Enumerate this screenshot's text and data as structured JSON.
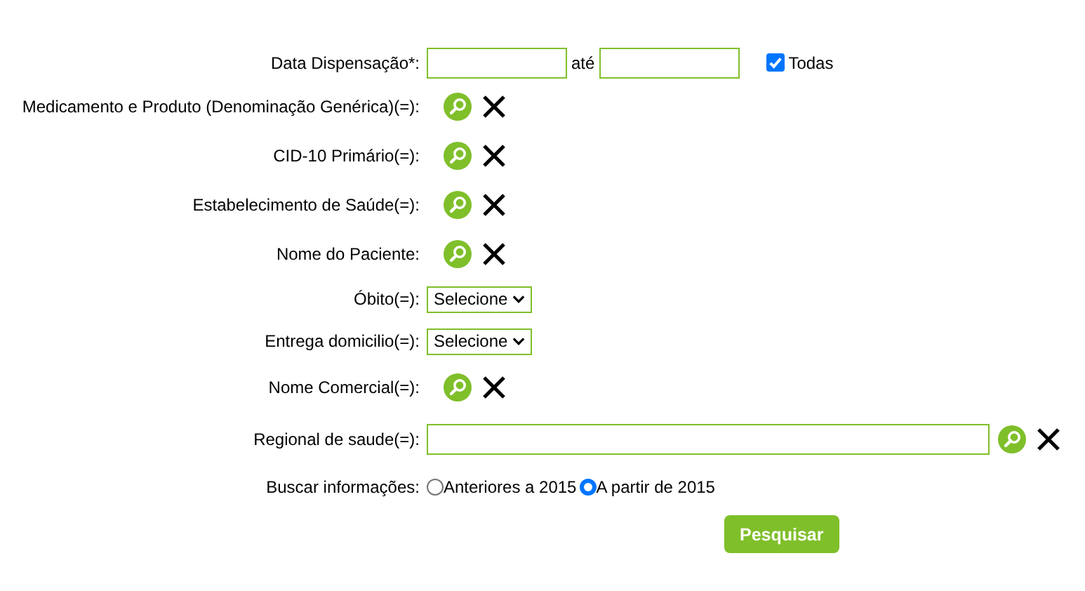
{
  "fields": [
    {
      "kind": "date_range",
      "label": "Data Dispensação*:",
      "separator": "até",
      "all_label": "Todas",
      "all_checked": true
    },
    {
      "kind": "lookup",
      "label": "Medicamento e Produto (Denominação Genérica)(=):"
    },
    {
      "kind": "lookup",
      "label": "CID-10 Primário(=):"
    },
    {
      "kind": "lookup",
      "label": "Estabelecimento de Saúde(=):"
    },
    {
      "kind": "lookup",
      "label": "Nome do Paciente:"
    },
    {
      "kind": "select",
      "label": "Óbito(=):",
      "value": "Selecione"
    },
    {
      "kind": "select",
      "label": "Entrega domicilio(=):",
      "value": "Selecione"
    },
    {
      "kind": "lookup",
      "label": "Nome Comercial(=):"
    },
    {
      "kind": "text_lookup",
      "label": "Regional de saude(=):"
    },
    {
      "kind": "radio",
      "label": "Buscar informações:",
      "options": [
        {
          "label": "Anteriores a 2015",
          "selected": false
        },
        {
          "label": "A partir de 2015",
          "selected": true
        }
      ]
    }
  ],
  "submit": "Pesquisar"
}
